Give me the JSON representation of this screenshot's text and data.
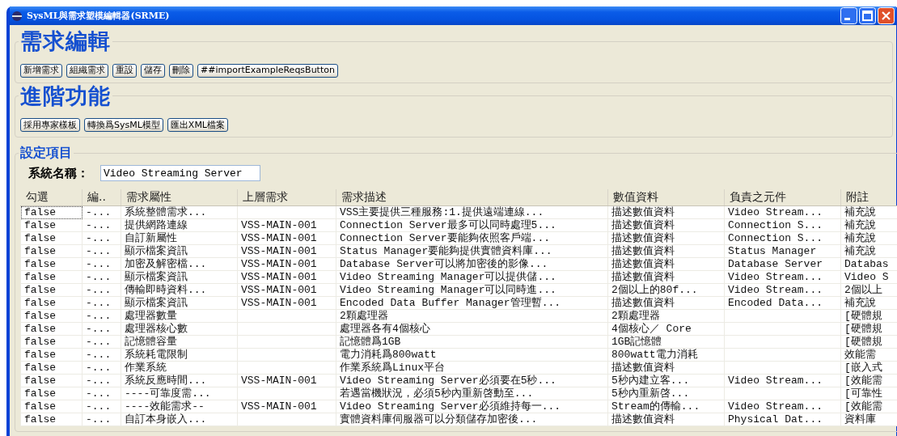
{
  "window": {
    "title": "SysML與需求塑模編輯器(SRME)"
  },
  "requirement_edit": {
    "title": "需求編輯",
    "buttons": [
      "新增需求",
      "組織需求",
      "重設",
      "儲存",
      "刪除",
      "##importExampleReqsButton"
    ]
  },
  "advanced": {
    "title": "進階功能",
    "buttons": [
      "採用專家樣板",
      "轉換爲SysML模型",
      "匯出XML檔案"
    ]
  },
  "settings": {
    "title": "設定項目",
    "system_name_label": "系統名稱：",
    "system_name_value": "Video Streaming Server"
  },
  "table": {
    "columns": [
      "勾選",
      "編..",
      "需求屬性",
      "上層需求",
      "需求描述",
      "數值資料",
      "負責之元件",
      "附註"
    ],
    "rows": [
      [
        "false",
        "-...",
        "系統整體需求...",
        "",
        "VSS主要提供三種服務:1.提供遠端連線...",
        "描述數值資料",
        "Video Stream...",
        "補充說"
      ],
      [
        "false",
        "-...",
        "提供網路連線",
        "VSS-MAIN-001",
        "Connection Server最多可以同時處理5...",
        "描述數值資料",
        "Connection S...",
        "補充說"
      ],
      [
        "false",
        "-...",
        "自訂新屬性",
        "VSS-MAIN-001",
        "Connection Server要能夠依照客戶端...",
        "描述數值資料",
        "Connection S...",
        "補充說"
      ],
      [
        "false",
        "-...",
        "顯示檔案資訊",
        "VSS-MAIN-001",
        "Status Manager要能夠提供實體資料庫...",
        "描述數值資料",
        "Status Manager",
        "補充說"
      ],
      [
        "false",
        "-...",
        "加密及解密檔...",
        "VSS-MAIN-001",
        "Database Server可以將加密後的影像...",
        "描述數值資料",
        "Database Server",
        "Databas"
      ],
      [
        "false",
        "-...",
        "顯示檔案資訊",
        "VSS-MAIN-001",
        "Video Streaming Manager可以提供儲...",
        "描述數值資料",
        "Video Stream...",
        "Video S"
      ],
      [
        "false",
        "-...",
        "傳輸即時資料...",
        "VSS-MAIN-001",
        "Video Streaming Manager可以同時進...",
        "2個以上的80f...",
        "Video Stream...",
        "2個以上"
      ],
      [
        "false",
        "-...",
        "顯示檔案資訊",
        "VSS-MAIN-001",
        "Encoded Data Buffer Manager管理暫...",
        "描述數值資料",
        "Encoded Data...",
        "補充說"
      ],
      [
        "false",
        "-...",
        "處理器數量",
        "",
        "2顆處理器",
        "2顆處理器",
        "",
        "[硬體規"
      ],
      [
        "false",
        "-...",
        "處理器核心數",
        "",
        "處理器各有4個核心",
        "4個核心／ Core",
        "",
        "[硬體規"
      ],
      [
        "false",
        "-...",
        "記憶體容量",
        "",
        "記憶體爲1GB",
        "1GB記憶體",
        "",
        "[硬體規"
      ],
      [
        "false",
        "-...",
        "系統耗電限制",
        "",
        "電力消耗爲800watt",
        "800watt電力消耗",
        "",
        "效能需"
      ],
      [
        "false",
        "-...",
        "作業系統",
        "",
        "作業系統爲Linux平台",
        "描述數值資料",
        "",
        "[嵌入式"
      ],
      [
        "false",
        "-...",
        "系統反應時間...",
        "VSS-MAIN-001",
        "Video Streaming Server必須要在5秒...",
        "5秒內建立客...",
        "Video Stream...",
        "[效能需"
      ],
      [
        "false",
        "-...",
        "----可靠度需...",
        "",
        "若遇當機狀況，必須5秒內重新啓動至...",
        "5秒內重新啓...",
        "",
        "[可靠性"
      ],
      [
        "false",
        "-...",
        "----效能需求--",
        "VSS-MAIN-001",
        "Video Streaming Server必須維持每一...",
        "Stream的傳輸...",
        "Video Stream...",
        "[效能需"
      ],
      [
        "false",
        "-...",
        "自訂本身嵌入...",
        "",
        "實體資料庫伺服器可以分類儲存加密後...",
        "描述數值資料",
        "Physical Dat...",
        "資料庫"
      ]
    ]
  }
}
